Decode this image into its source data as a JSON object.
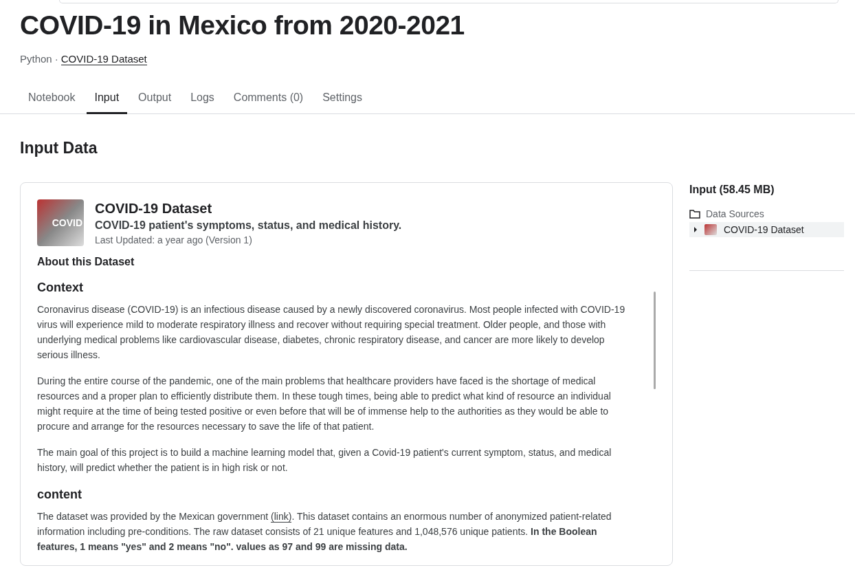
{
  "title": "COVID-19 in Mexico from 2020-2021",
  "subtitle": {
    "language": "Python",
    "separator": "·",
    "dataset_link": "COVID-19 Dataset"
  },
  "tabs": [
    {
      "label": "Notebook",
      "selected": false
    },
    {
      "label": "Input",
      "selected": true
    },
    {
      "label": "Output",
      "selected": false
    },
    {
      "label": "Logs",
      "selected": false
    },
    {
      "label": "Comments (0)",
      "selected": false
    },
    {
      "label": "Settings",
      "selected": false
    }
  ],
  "section_title": "Input Data",
  "dataset": {
    "thumbnail_text": "COVID",
    "name": "COVID-19 Dataset",
    "tagline": "COVID-19 patient's symptoms, status, and medical history.",
    "updated": "Last Updated: a year ago (Version 1)",
    "about": "About this Dataset",
    "blocks": [
      {
        "kind": "heading",
        "text": "Context"
      },
      {
        "kind": "paragraph",
        "text": "Coronavirus disease (COVID-19) is an infectious disease caused by a newly discovered coronavirus. Most people infected with COVID-19 virus will experience mild to moderate respiratory illness and recover without requiring special treatment. Older people, and those with underlying medical problems like cardiovascular disease, diabetes, chronic respiratory disease, and cancer are more likely to develop serious illness."
      },
      {
        "kind": "paragraph",
        "text": "During the entire course of the pandemic, one of the main problems that healthcare providers have faced is the shortage of medical resources and a proper plan to efficiently distribute them. In these tough times, being able to predict what kind of resource an individual might require at the time of being tested positive or even before that will be of immense help to the authorities as they would be able to procure and arrange for the resources necessary to save the life of that patient."
      },
      {
        "kind": "paragraph",
        "text": "The main goal of this project is to build a machine learning model that, given a Covid-19 patient's current symptom, status, and medical history, will predict whether the patient is in high risk or not."
      },
      {
        "kind": "heading",
        "text": "content"
      },
      {
        "kind": "link_paragraph",
        "before": "The dataset was provided by the Mexican government ",
        "link": "(link)",
        "after": ". This dataset contains an enormous number of anonymized patient-related information including pre-conditions. The raw dataset consists of 21 unique features and 1,048,576 unique patients. **In the Boolean features, 1 means \"yes\" and 2 means \"no\". values as 97 and 99 are missing data.**"
      }
    ]
  },
  "sidebar": {
    "title": "Input (58.45 MB)",
    "group": "Data Sources",
    "items": [
      {
        "label": "COVID-19 Dataset",
        "expanded": false,
        "selected": true
      }
    ]
  }
}
